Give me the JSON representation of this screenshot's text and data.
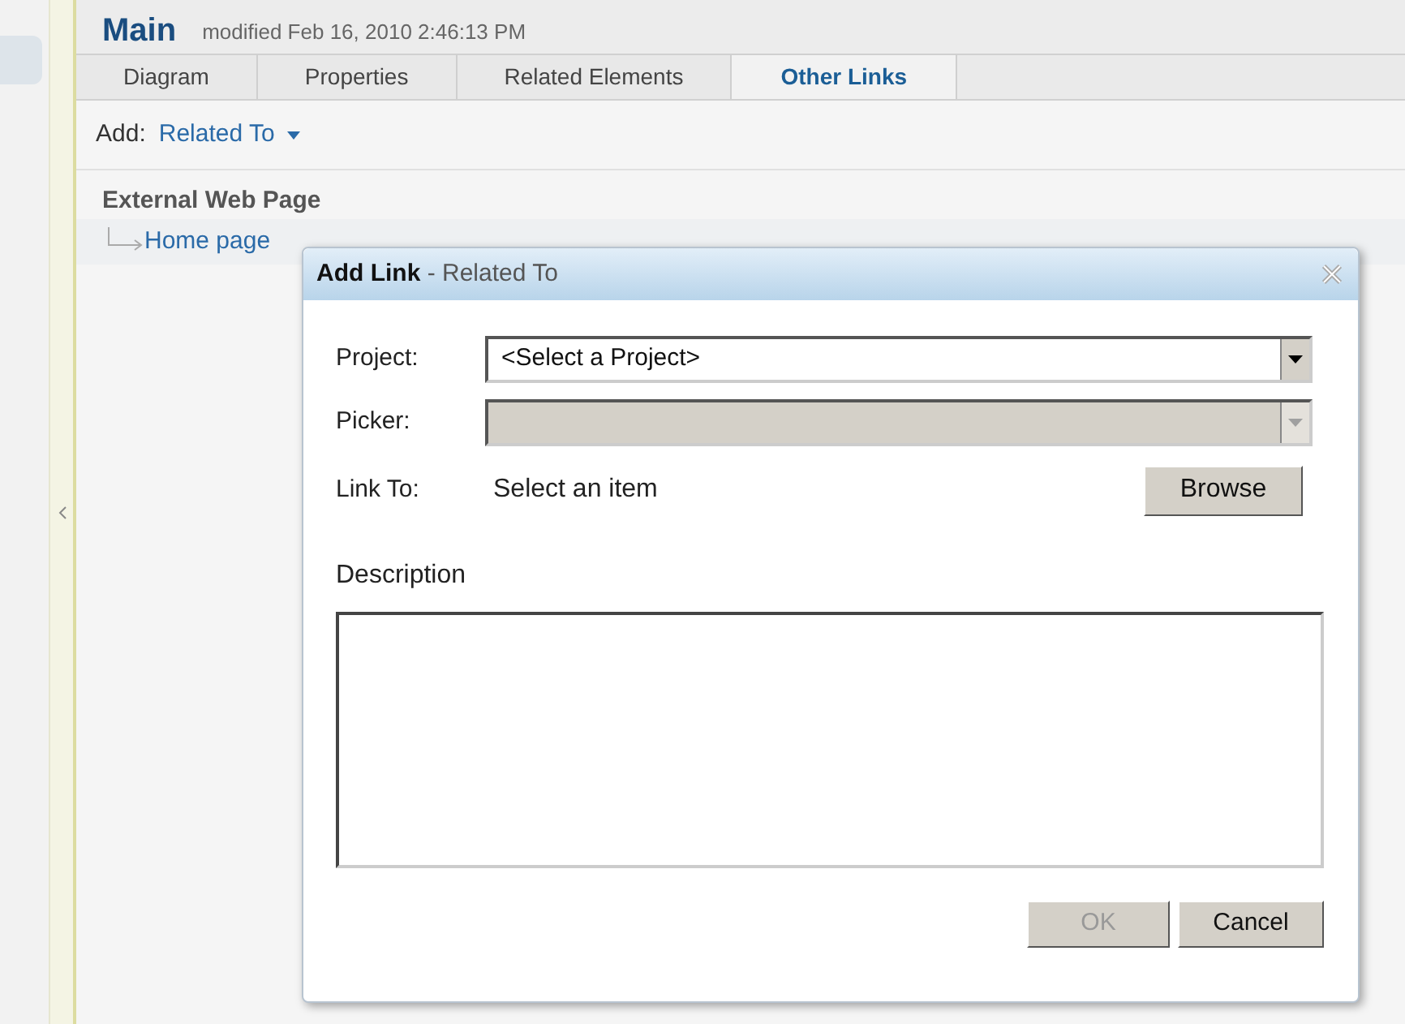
{
  "header": {
    "title": "Main",
    "modified": "modified Feb 16, 2010 2:46:13 PM"
  },
  "tabs": [
    {
      "label": "Diagram",
      "selected": false
    },
    {
      "label": "Properties",
      "selected": false
    },
    {
      "label": "Related Elements",
      "selected": false
    },
    {
      "label": "Other Links",
      "selected": true
    }
  ],
  "add_bar": {
    "label": "Add:",
    "menu": "Related To"
  },
  "sections": [
    {
      "title": "External Web Page",
      "links": [
        "Home page"
      ]
    }
  ],
  "dialog": {
    "title": "Add Link",
    "subtitle": "- Related To",
    "fields": [
      {
        "kind": "select",
        "label": "Project:",
        "value": "<Select a Project>",
        "disabled": false
      },
      {
        "kind": "select",
        "label": "Picker:",
        "disabled": true
      },
      {
        "kind": "link",
        "label": "Link To:",
        "value": "Select an item",
        "button": "Browse"
      }
    ],
    "description_label": "Description",
    "buttons": [
      {
        "label": "OK",
        "disabled": true
      },
      {
        "label": "Cancel",
        "disabled": false
      }
    ]
  }
}
